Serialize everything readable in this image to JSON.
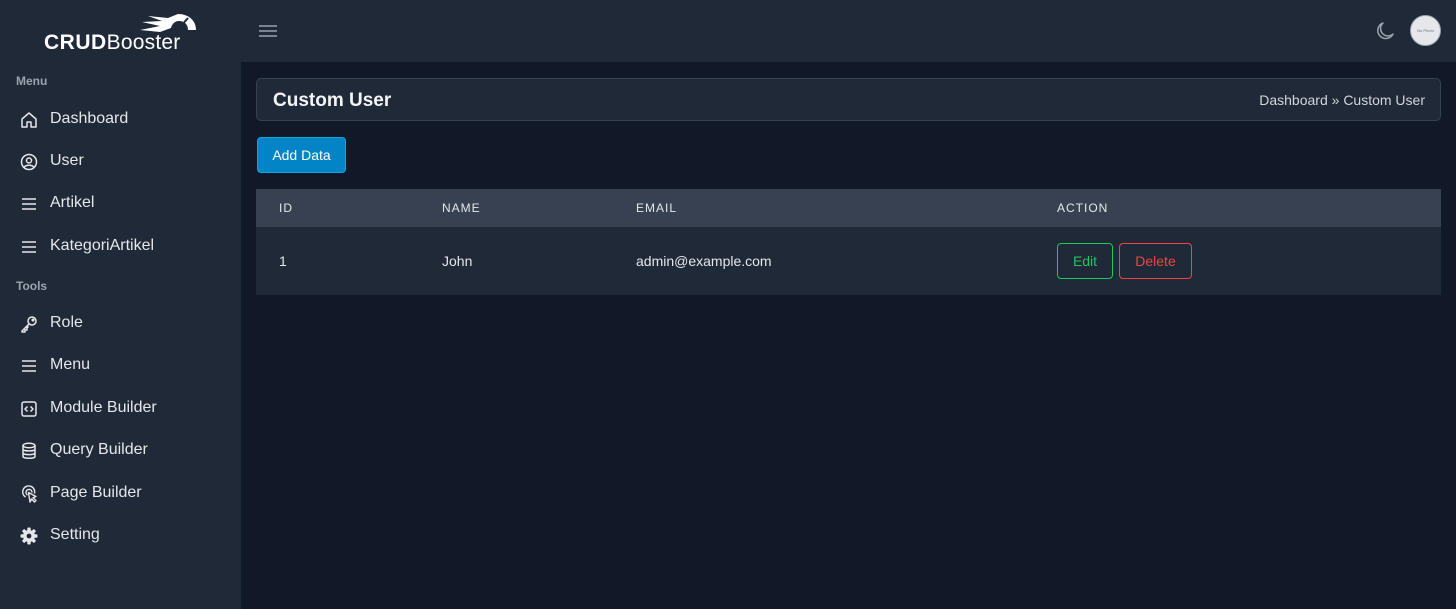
{
  "brand": {
    "name_bold": "CRUD",
    "name_rest": "Booster"
  },
  "sidebar": {
    "sections": [
      {
        "label": "Menu",
        "items": [
          {
            "label": "Dashboard",
            "icon": "home-icon"
          },
          {
            "label": "User",
            "icon": "user-circle-icon"
          },
          {
            "label": "Artikel",
            "icon": "list-icon"
          },
          {
            "label": "KategoriArtikel",
            "icon": "list-icon"
          }
        ]
      },
      {
        "label": "Tools",
        "items": [
          {
            "label": "Role",
            "icon": "key-icon"
          },
          {
            "label": "Menu",
            "icon": "list-icon"
          },
          {
            "label": "Module Builder",
            "icon": "code-icon"
          },
          {
            "label": "Query Builder",
            "icon": "database-icon"
          },
          {
            "label": "Page Builder",
            "icon": "pointer-icon"
          },
          {
            "label": "Setting",
            "icon": "gear-icon"
          }
        ]
      }
    ]
  },
  "topbar": {
    "avatar_text": "No Photo",
    "menu_icon": "hamburger-icon",
    "theme_icon": "moon-icon"
  },
  "header": {
    "title": "Custom User",
    "breadcrumb": {
      "home": "Dashboard",
      "separator": "»",
      "current": "Custom User"
    }
  },
  "actions": {
    "add_label": "Add Data"
  },
  "table": {
    "columns": [
      "ID",
      "NAME",
      "EMAIL",
      "ACTION"
    ],
    "rows": [
      {
        "id": "1",
        "name": "John",
        "email": "admin@example.com",
        "edit_label": "Edit",
        "delete_label": "Delete"
      }
    ]
  },
  "colors": {
    "background": "#111827",
    "panel": "#1f2937",
    "table_header": "#374151",
    "primary": "#0284c7",
    "success": "#22c55e",
    "danger": "#ef4444"
  }
}
